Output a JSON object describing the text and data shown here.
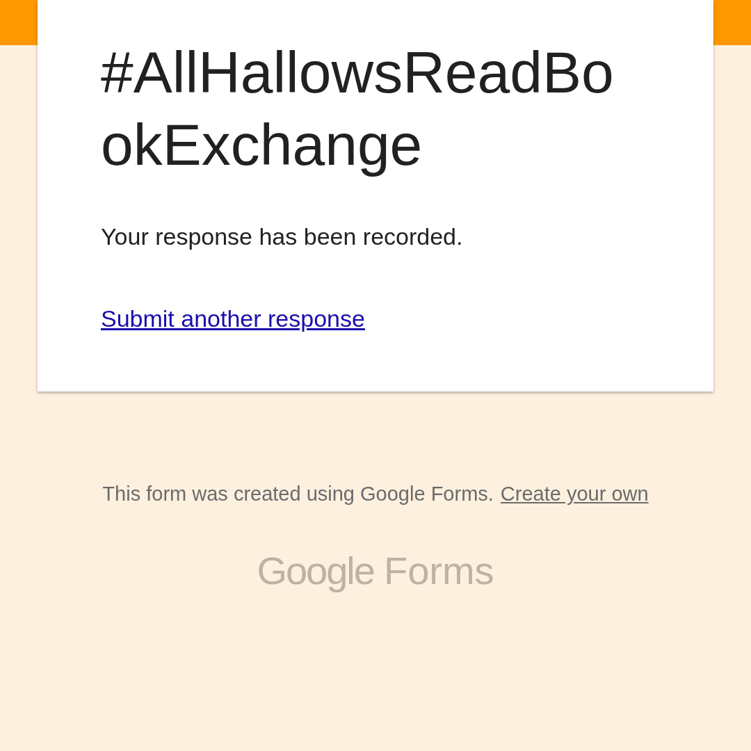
{
  "form": {
    "title": "#AllHallowsReadBookExchange",
    "message": "Your response has been recorded.",
    "link": "Submit another response"
  },
  "footer": {
    "note": "This form was created using Google Forms.",
    "link": "Create your own"
  },
  "logo": {
    "brand": "Google",
    "product": "Forms"
  }
}
